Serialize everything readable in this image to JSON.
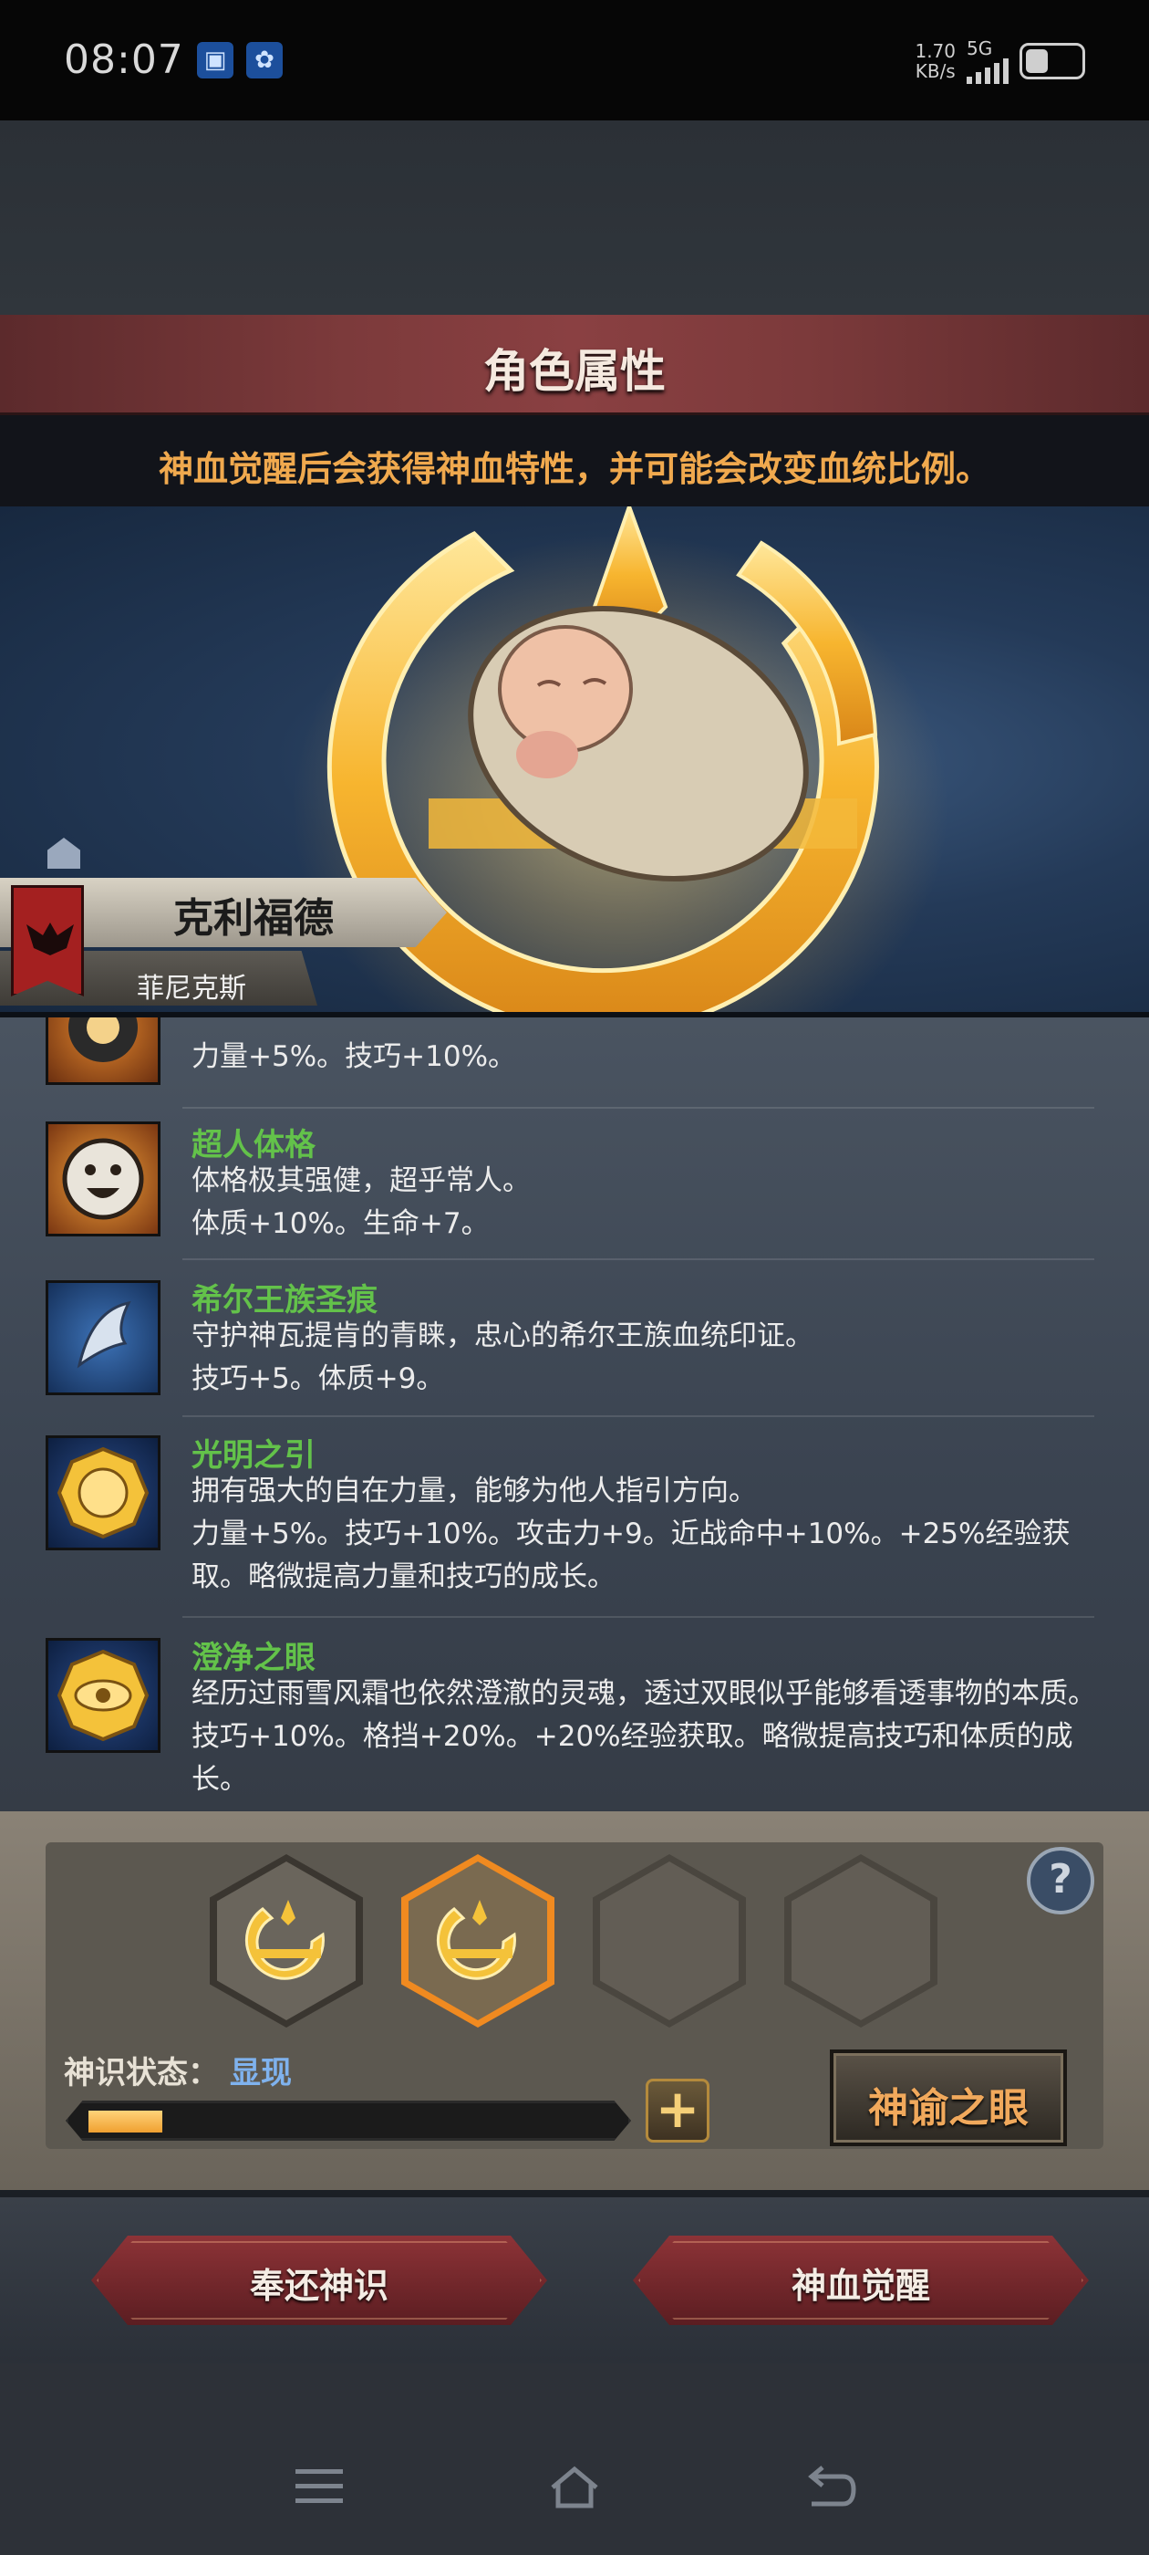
{
  "status_bar": {
    "time": "08:07",
    "speed_value": "1.70",
    "speed_unit": "KB/s",
    "network": "5G",
    "icons": [
      "app-notification-icon",
      "paw-app-icon",
      "signal-icon",
      "battery-icon"
    ]
  },
  "header": {
    "title": "角色属性",
    "notice": "神血觉醒后会获得神血特性，并可能会改变血统比例。"
  },
  "character": {
    "name": "克利福德",
    "house": "菲尼克斯"
  },
  "traits": [
    {
      "name": "",
      "desc_lines": [
        "力量+5%。技巧+10%。"
      ],
      "icon": "eye-emblem-icon",
      "colors": [
        "#e6892e",
        "#6b2f10"
      ]
    },
    {
      "name": "超人体格",
      "desc_lines": [
        "体格极其强健，超乎常人。",
        "体质+10%。生命+7。"
      ],
      "icon": "smiley-face-icon",
      "colors": [
        "#f5a33a",
        "#7a3612"
      ]
    },
    {
      "name": "希尔王族圣痕",
      "desc_lines": [
        "守护神瓦提肯的青睐，忠心的希尔王族血统印证。",
        "技巧+5。体质+9。"
      ],
      "icon": "royal-feather-icon",
      "colors": [
        "#3d73b8",
        "#15305a"
      ]
    },
    {
      "name": "光明之引",
      "desc_lines": [
        "拥有强大的自在力量，能够为他人指引方向。",
        "力量+5%。技巧+10%。攻击力+9。近战命中+10%。+25%经验获",
        "取。略微提高力量和技巧的成长。"
      ],
      "icon": "golden-sun-medallion-icon",
      "colors": [
        "#2b4c8a",
        "#0d1f40"
      ]
    },
    {
      "name": "澄净之眼",
      "desc_lines": [
        "经历过雨雪风霜也依然澄澈的灵魂，透过双眼似乎能够看透事物的本质。",
        "技巧+10%。格挡+20%。+20%经验获取。略微提高技巧和体质的成",
        "长。"
      ],
      "icon": "golden-eye-medallion-icon",
      "colors": [
        "#2b4c8a",
        "#0d1f40"
      ]
    }
  ],
  "panel": {
    "slots": [
      {
        "state": "filled",
        "icon": "divine-crescent-icon"
      },
      {
        "state": "selected",
        "icon": "divine-crescent-icon"
      },
      {
        "state": "empty",
        "icon": ""
      },
      {
        "state": "empty",
        "icon": ""
      }
    ],
    "help": "?",
    "status_label": "神识状态：",
    "status_value": "显现",
    "progress": 0.14,
    "plus": "+",
    "oracle_button": "神谕之眼"
  },
  "actions": {
    "return_button": "奉还神识",
    "awaken_button": "神血觉醒"
  },
  "nav": {
    "icons": [
      "menu-icon",
      "home-icon",
      "back-icon"
    ]
  },
  "colors": {
    "trait_name": "#63c24a",
    "notice": "#f0a94e",
    "status_value": "#7fb2ee",
    "oracle_text": "#f1a95c",
    "button_red": "#8d3337"
  }
}
